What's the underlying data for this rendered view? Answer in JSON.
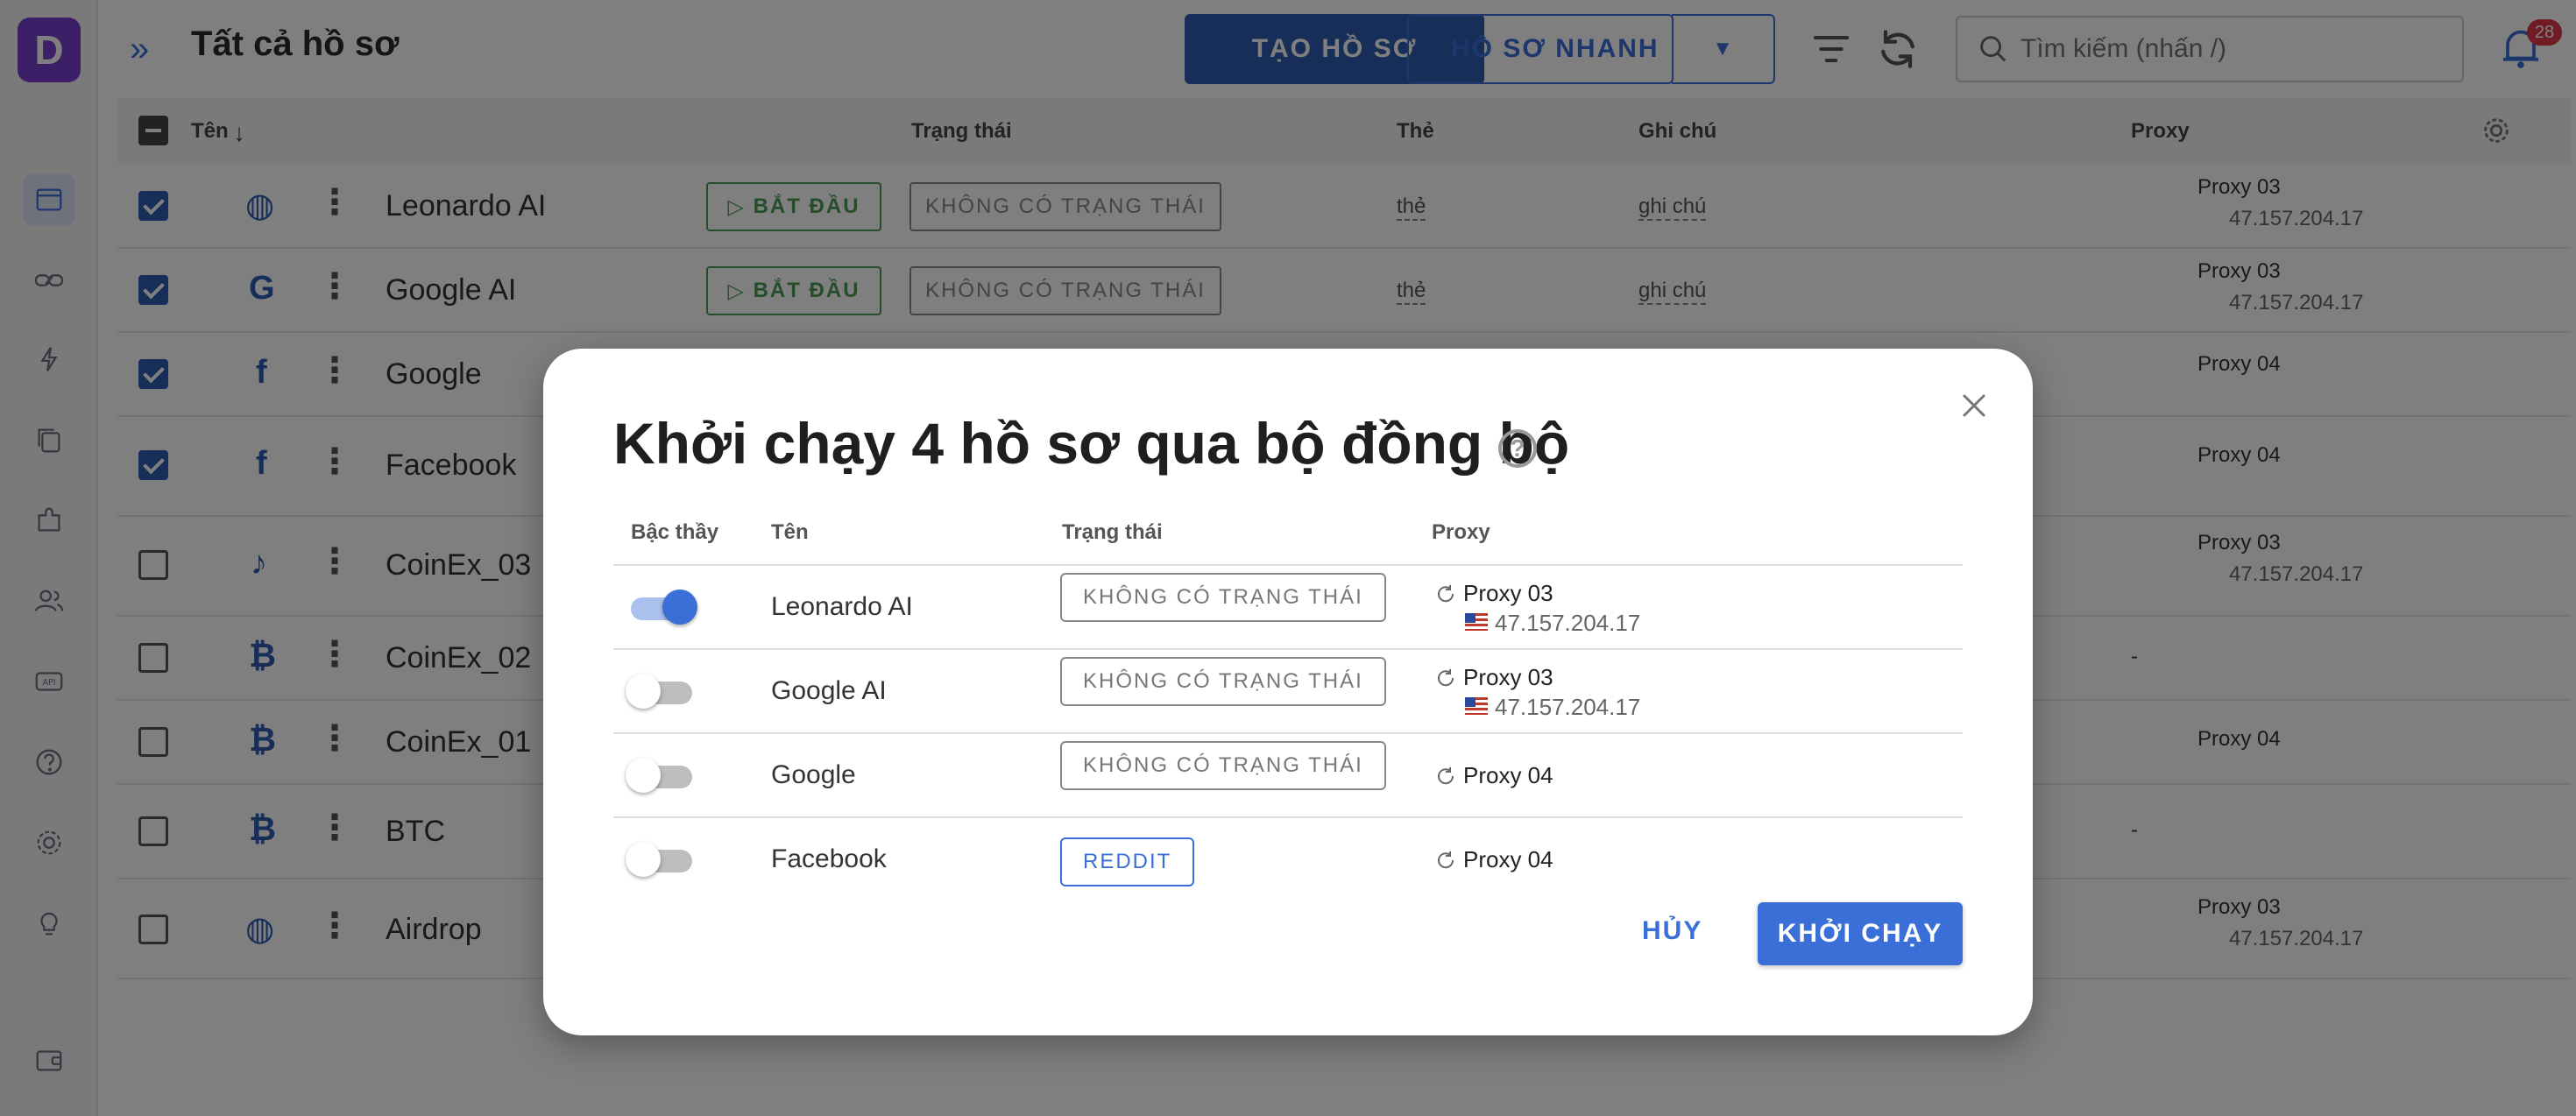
{
  "app": {
    "logo_letter": "D",
    "page_title": "Tất cả hồ sơ",
    "notification_count": "28"
  },
  "header": {
    "create_label": "TẠO HỒ SƠ",
    "quick_label": "HỒ SƠ NHANH",
    "search_placeholder": "Tìm kiếm (nhấn /)"
  },
  "table": {
    "columns": {
      "name": "Tên",
      "status": "Trạng thái",
      "tag": "Thẻ",
      "note": "Ghi chú",
      "proxy": "Proxy"
    },
    "rows": [
      {
        "name": "Leonardo AI",
        "checked": true,
        "icon": "globe-icon",
        "start": "BẮT ĐẦU",
        "status": "KHÔNG CÓ TRẠNG THÁI",
        "tag": "thẻ",
        "note": "ghi chú",
        "proxy": "Proxy 03",
        "ip": "47.157.204.17"
      },
      {
        "name": "Google AI",
        "checked": true,
        "icon": "google-icon",
        "start": "BẮT ĐẦU",
        "status": "KHÔNG CÓ TRẠNG THÁI",
        "tag": "thẻ",
        "note": "ghi chú",
        "proxy": "Proxy 03",
        "ip": "47.157.204.17"
      },
      {
        "name": "Google",
        "checked": true,
        "icon": "facebook-icon",
        "proxy": "Proxy 04"
      },
      {
        "name": "Facebook",
        "checked": true,
        "icon": "facebook-icon",
        "proxy": "Proxy 04"
      },
      {
        "name": "CoinEx_03",
        "checked": false,
        "icon": "tiktok-icon",
        "proxy": "Proxy 03",
        "ip": "47.157.204.17"
      },
      {
        "name": "CoinEx_02",
        "checked": false,
        "icon": "bitcoin-icon",
        "proxy": "-"
      },
      {
        "name": "CoinEx_01",
        "checked": false,
        "icon": "bitcoin-icon",
        "proxy": "Proxy 04"
      },
      {
        "name": "BTC",
        "checked": false,
        "icon": "bitcoin-icon",
        "proxy": "-"
      },
      {
        "name": "Airdrop",
        "checked": false,
        "icon": "globe-icon",
        "proxy": "Proxy 03",
        "ip": "47.157.204.17"
      }
    ]
  },
  "modal": {
    "title": "Khởi chạy 4 hồ sơ qua bộ đồng bộ",
    "help_symbol": "?",
    "columns": {
      "master": "Bậc thầy",
      "name": "Tên",
      "status": "Trạng thái",
      "proxy": "Proxy"
    },
    "rows": [
      {
        "name": "Leonardo AI",
        "master": true,
        "status": "KHÔNG CÓ TRẠNG THÁI",
        "proxy": "Proxy 03",
        "ip": "47.157.204.17"
      },
      {
        "name": "Google AI",
        "master": false,
        "status": "KHÔNG CÓ TRẠNG THÁI",
        "proxy": "Proxy 03",
        "ip": "47.157.204.17"
      },
      {
        "name": "Google",
        "master": false,
        "status": "KHÔNG CÓ TRẠNG THÁI",
        "proxy": "Proxy 04"
      },
      {
        "name": "Facebook",
        "master": false,
        "status": "REDDIT",
        "proxy": "Proxy 04"
      }
    ],
    "cancel_label": "HỦY",
    "launch_label": "KHỞI CHẠY"
  },
  "colors": {
    "accent": "#3a6fd8",
    "primary_dark": "#2f5fb0",
    "start_green": "#4c9a52",
    "badge_red": "#e0394a",
    "logo_purple": "#7b3fd0"
  }
}
